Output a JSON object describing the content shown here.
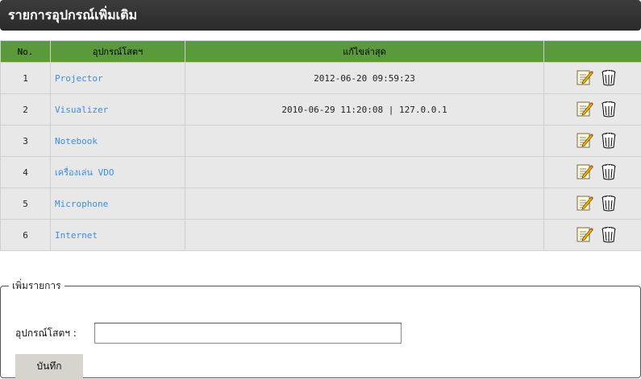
{
  "header": {
    "title": "รายการอุปกรณ์เพิ่มเติม"
  },
  "table": {
    "columns": {
      "no": "No.",
      "name": "อุปกรณ์โสตฯ",
      "updated": "แก้ไขล่าสุด",
      "actions": ""
    },
    "rows": [
      {
        "no": "1",
        "name": "Projector",
        "updated": "2012-06-20 09:59:23"
      },
      {
        "no": "2",
        "name": "Visualizer",
        "updated": "2010-06-29 11:20:08 | 127.0.0.1"
      },
      {
        "no": "3",
        "name": "Notebook",
        "updated": ""
      },
      {
        "no": "4",
        "name": "เครื่องเล่น VDO",
        "updated": ""
      },
      {
        "no": "5",
        "name": "Microphone",
        "updated": ""
      },
      {
        "no": "6",
        "name": "Internet",
        "updated": ""
      }
    ],
    "icons": {
      "edit": "edit-note-icon",
      "delete": "trash-can-icon"
    }
  },
  "form": {
    "legend": "เพิ่มรายการ",
    "label": "อุปกรณ์โสตฯ  :",
    "input_value": "",
    "save_label": "บันทึก"
  },
  "colors": {
    "header_bg": "#2e2e2e",
    "table_header_bg": "#5a9a3c",
    "row_bg": "#e8e8e8",
    "link": "#3b8ee0",
    "button_bg": "#d7d4cd"
  }
}
